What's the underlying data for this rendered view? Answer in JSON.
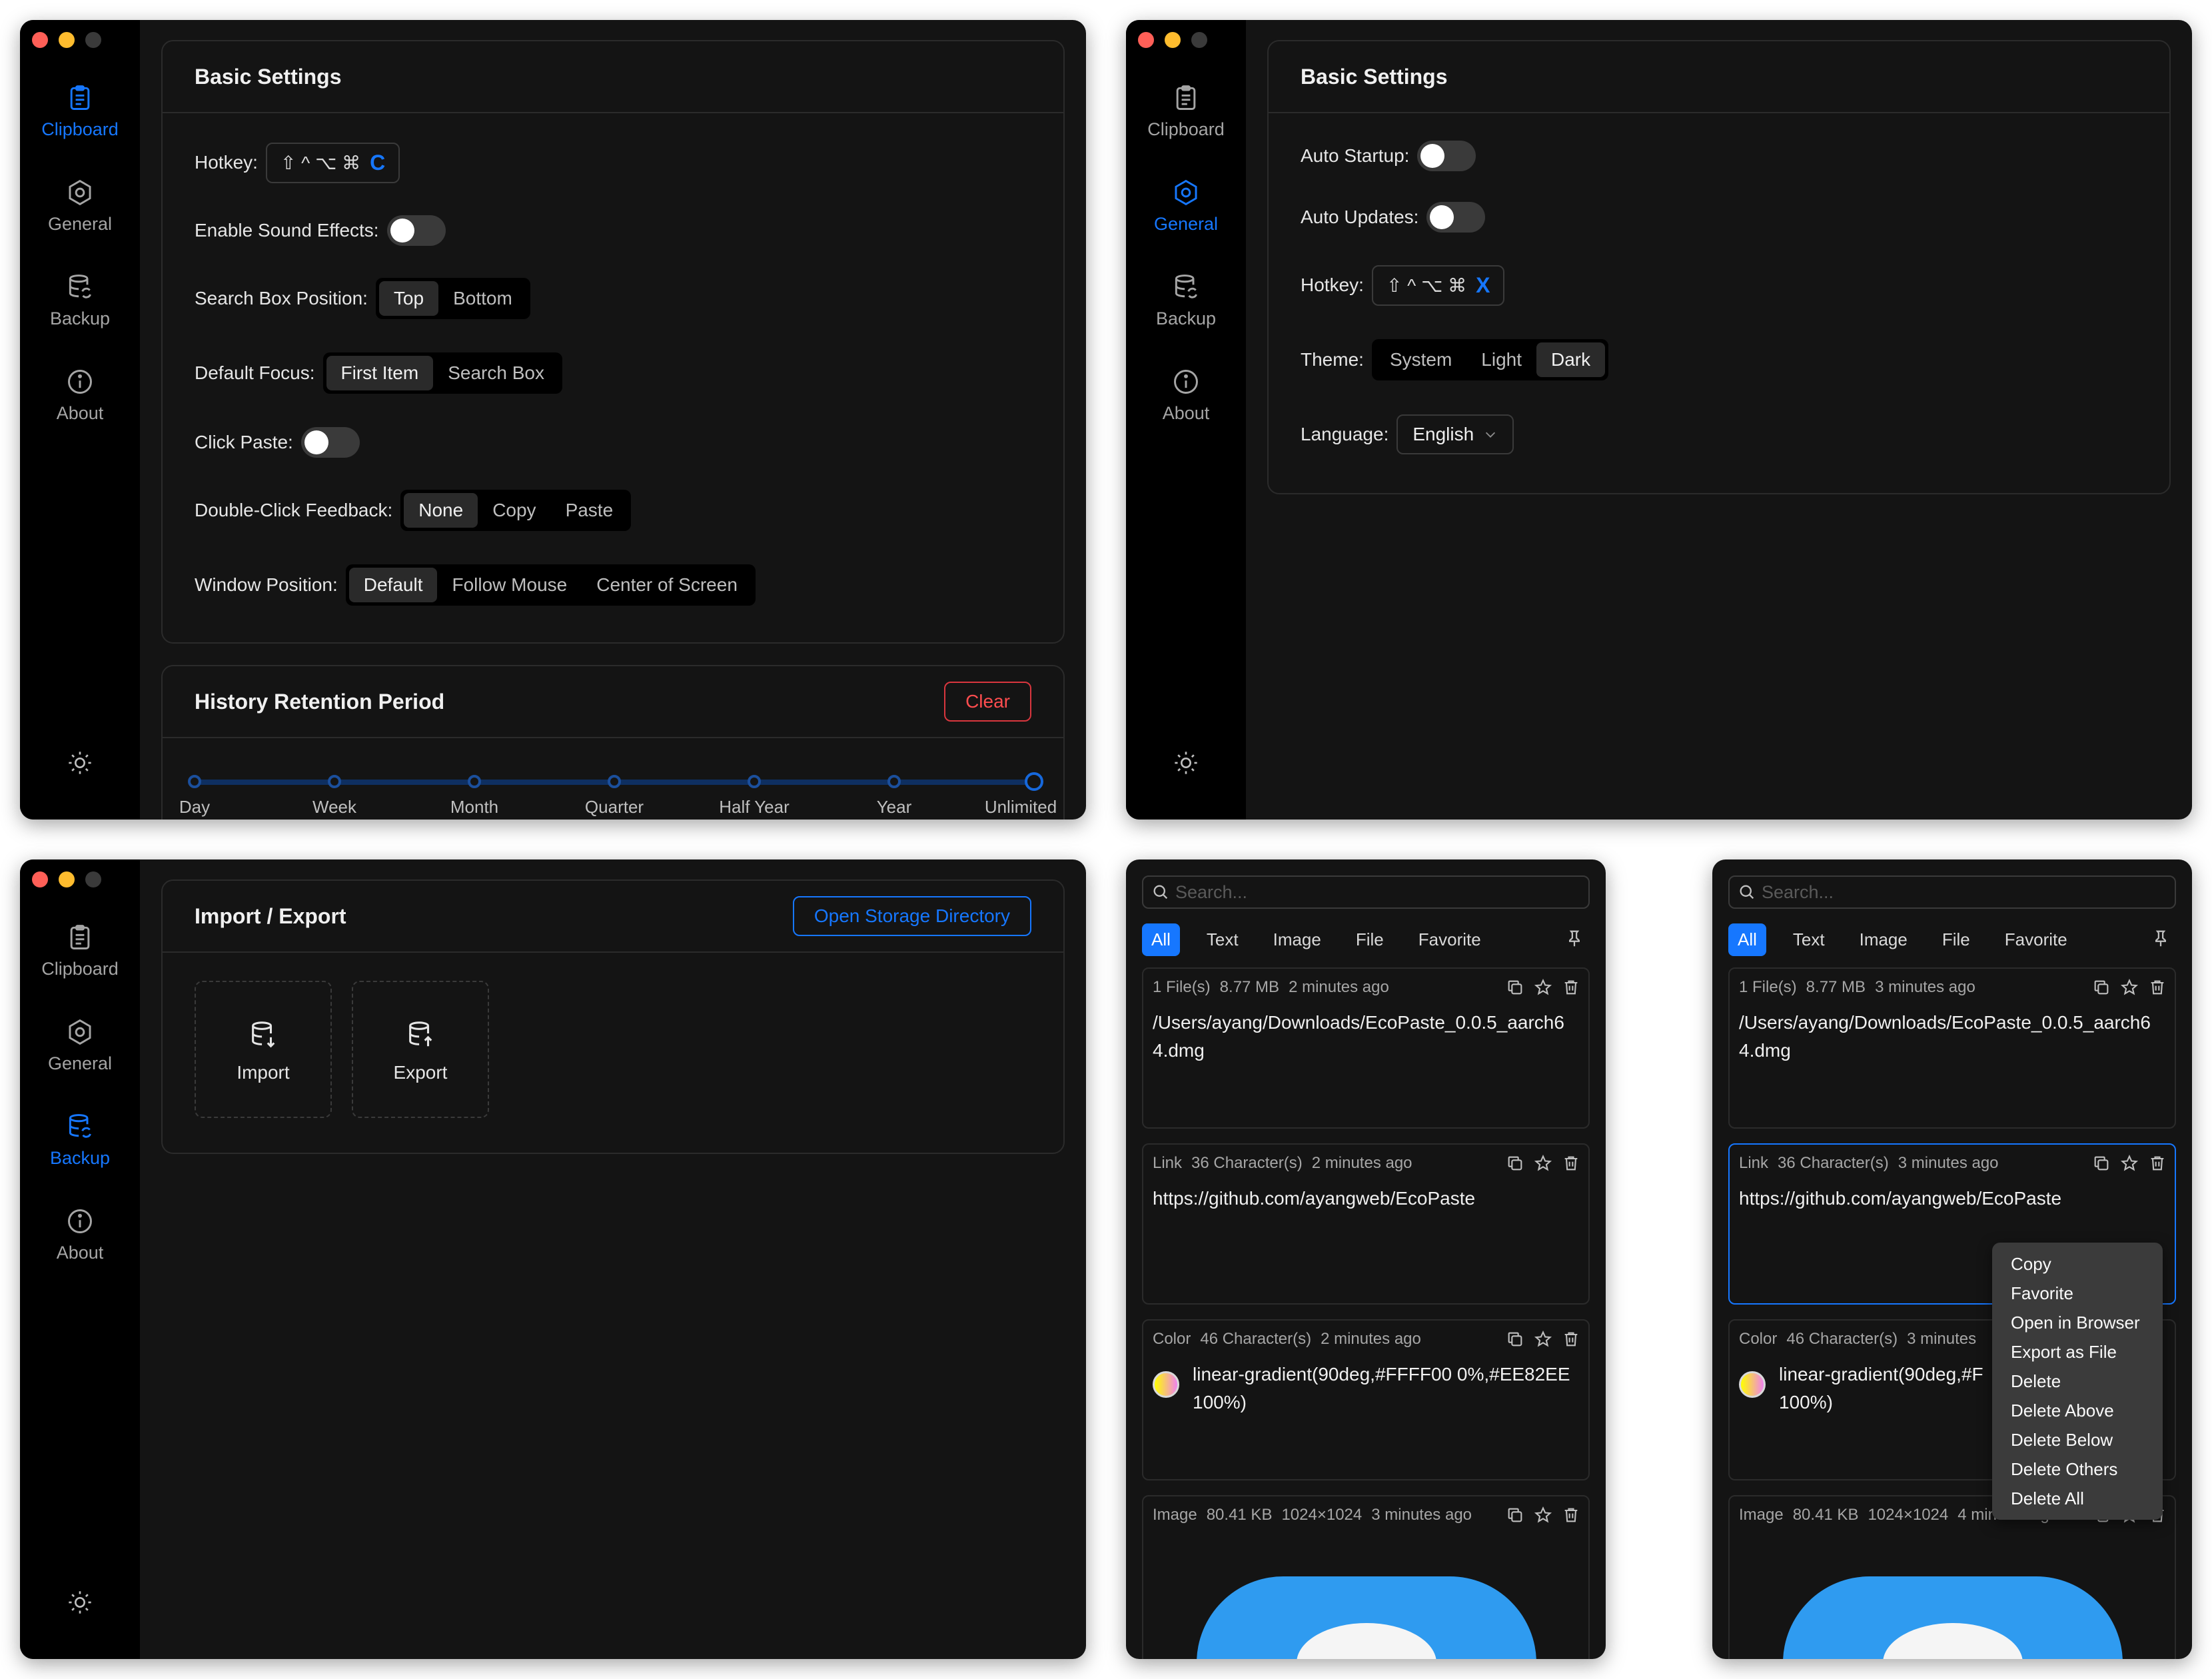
{
  "nav": {
    "clipboard": "Clipboard",
    "general": "General",
    "backup": "Backup",
    "about": "About"
  },
  "clipboard_settings": {
    "basic_title": "Basic Settings",
    "hotkey_label": "Hotkey:",
    "hotkey_modifiers": "⇧ ^ ⌥ ⌘",
    "hotkey_key": "C",
    "sound_label": "Enable Sound Effects:",
    "sound_enabled": false,
    "search_pos_label": "Search Box Position:",
    "search_pos_options": [
      "Top",
      "Bottom"
    ],
    "search_pos_selected": "Top",
    "focus_label": "Default Focus:",
    "focus_options": [
      "First Item",
      "Search Box"
    ],
    "focus_selected": "First Item",
    "click_paste_label": "Click Paste:",
    "click_paste_enabled": false,
    "dblclick_label": "Double-Click Feedback:",
    "dblclick_options": [
      "None",
      "Copy",
      "Paste"
    ],
    "dblclick_selected": "None",
    "winpos_label": "Window Position:",
    "winpos_options": [
      "Default",
      "Follow Mouse",
      "Center of Screen"
    ],
    "winpos_selected": "Default",
    "history_title": "History Retention Period",
    "clear_label": "Clear",
    "retention_marks": [
      "Day",
      "Week",
      "Month",
      "Quarter",
      "Half Year",
      "Year",
      "Unlimited"
    ],
    "retention_selected": "Unlimited"
  },
  "general_settings": {
    "basic_title": "Basic Settings",
    "auto_startup_label": "Auto Startup:",
    "auto_startup_enabled": false,
    "auto_updates_label": "Auto Updates:",
    "auto_updates_enabled": false,
    "hotkey_label": "Hotkey:",
    "hotkey_modifiers": "⇧ ^ ⌥ ⌘",
    "hotkey_key": "X",
    "theme_label": "Theme:",
    "theme_options": [
      "System",
      "Light",
      "Dark"
    ],
    "theme_selected": "Dark",
    "language_label": "Language:",
    "language_value": "English"
  },
  "backup_settings": {
    "title": "Import / Export",
    "open_dir_label": "Open Storage Directory",
    "import_label": "Import",
    "export_label": "Export"
  },
  "clipboard_panel": {
    "search_placeholder": "Search...",
    "tabs": [
      "All",
      "Text",
      "Image",
      "File",
      "Favorite"
    ],
    "active_tab": "All",
    "items_a": [
      {
        "type": "1 File(s)",
        "size": "8.77 MB",
        "time": "2 minutes ago",
        "content": "/Users/ayang/Downloads/EcoPaste_0.0.5_aarch64.dmg"
      },
      {
        "type": "Link",
        "size": "36 Character(s)",
        "time": "2 minutes ago",
        "content": "https://github.com/ayangweb/EcoPaste"
      },
      {
        "type": "Color",
        "size": "46 Character(s)",
        "time": "2 minutes ago",
        "content": "linear-gradient(90deg,#FFFF00 0%,#EE82EE 100%)"
      },
      {
        "type": "Image",
        "size": "80.41 KB",
        "dims": "1024×1024",
        "time": "3 minutes ago"
      }
    ],
    "items_b": [
      {
        "type": "1 File(s)",
        "size": "8.77 MB",
        "time": "3 minutes ago",
        "content": "/Users/ayang/Downloads/EcoPaste_0.0.5_aarch64.dmg"
      },
      {
        "type": "Link",
        "size": "36 Character(s)",
        "time": "3 minutes ago",
        "content": "https://github.com/ayangweb/EcoPaste"
      },
      {
        "type": "Color",
        "size": "46 Character(s)",
        "time": "3 minutes",
        "content": "linear-gradient(90deg,#F"
      },
      {
        "type": "Image",
        "size": "80.41 KB",
        "dims": "1024×1024",
        "time": "4 minutes ago"
      }
    ],
    "color_line2": "100%)",
    "context_menu": [
      "Copy",
      "Favorite",
      "Open in Browser",
      "Export as File",
      "Delete",
      "Delete Above",
      "Delete Below",
      "Delete Others",
      "Delete All"
    ]
  },
  "colors": {
    "accent": "#1677ff",
    "danger": "#ff4d4f",
    "light_red": "#ff5f57",
    "light_yellow": "#febc2e",
    "light_gray": "#3a3a3a"
  }
}
